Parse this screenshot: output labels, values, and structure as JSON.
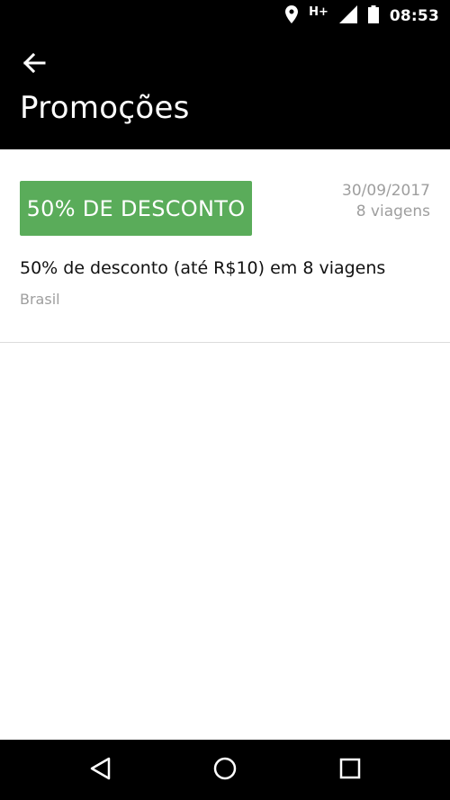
{
  "status_bar": {
    "network": "H+",
    "time": "08:53",
    "icons": [
      "location-icon",
      "signal-icon",
      "battery-icon"
    ]
  },
  "app_bar": {
    "title": "Promoções",
    "back_icon": "arrow-left-icon"
  },
  "promotions": [
    {
      "badge": "50% DE DESCONTO",
      "date": "30/09/2017",
      "trips": "8 viagens",
      "description": "50% de desconto (até R$10) em 8 viagens",
      "region": "Brasil"
    }
  ],
  "nav_bar": {
    "icons": [
      "back-triangle-icon",
      "home-circle-icon",
      "recents-square-icon"
    ]
  },
  "colors": {
    "badge_bg": "#5aac5a",
    "bar_bg": "#000000",
    "muted_text": "#9e9e9e"
  }
}
